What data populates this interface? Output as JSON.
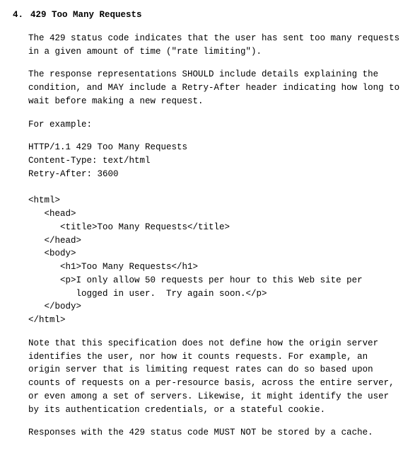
{
  "section": {
    "number": "4.",
    "title": "429 Too Many Requests",
    "para1": "The 429 status code indicates that the user has sent too many requests in a given amount of time (\"rate limiting\").",
    "para2": "The response representations SHOULD include details explaining the condition, and MAY include a Retry-After header indicating how long to wait before making a new request.",
    "para3": "For example:",
    "code": "HTTP/1.1 429 Too Many Requests\nContent-Type: text/html\nRetry-After: 3600\n\n<html>\n   <head>\n      <title>Too Many Requests</title>\n   </head>\n   <body>\n      <h1>Too Many Requests</h1>\n      <p>I only allow 50 requests per hour to this Web site per\n         logged in user.  Try again soon.</p>\n   </body>\n</html>",
    "para4": "Note that this specification does not define how the origin server identifies the user, nor how it counts requests.  For example, an origin server that is limiting request rates can do so based upon counts of requests on a per-resource basis, across the entire server, or even among a set of servers.  Likewise, it might identify the user by its authentication credentials, or a stateful cookie.",
    "para5": "Responses with the 429 status code MUST NOT be stored by a cache."
  }
}
